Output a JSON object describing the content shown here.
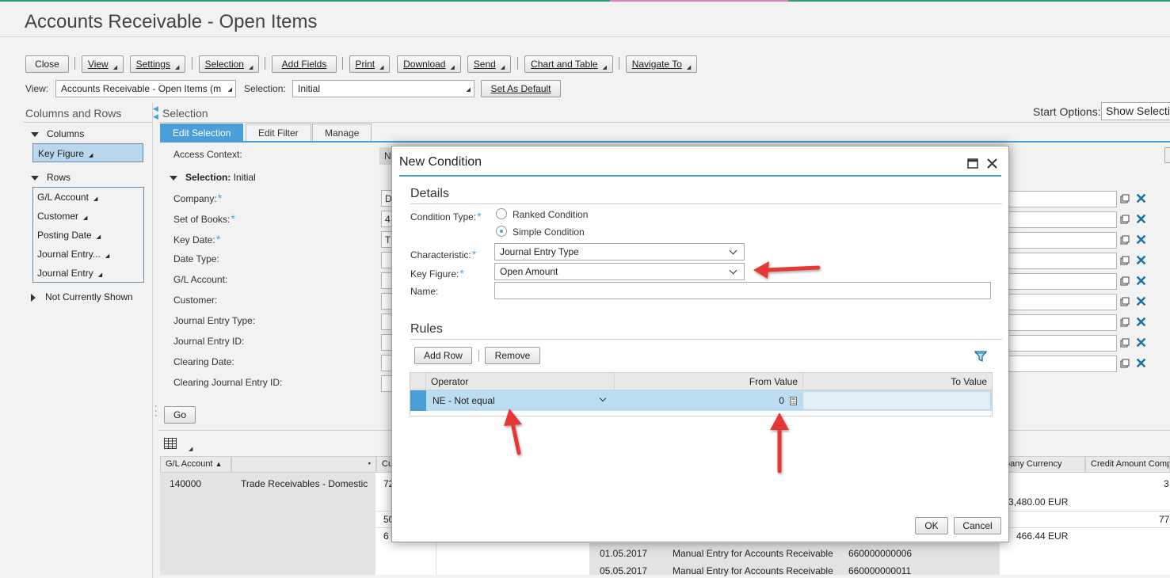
{
  "page": {
    "title": "Accounts Receivable - Open Items"
  },
  "toolbar": {
    "close": "Close",
    "view": "View",
    "settings": "Settings",
    "selection": "Selection",
    "add_fields": "Add Fields",
    "print": "Print",
    "download": "Download",
    "send": "Send",
    "chart_and_table": "Chart and Table",
    "navigate_to": "Navigate To"
  },
  "view_bar": {
    "view_label": "View:",
    "view_value": "Accounts Receivable - Open Items (m",
    "selection_label": "Selection:",
    "selection_value": "Initial",
    "set_default": "Set As Default"
  },
  "left_panel": {
    "title": "Columns and Rows",
    "columns_label": "Columns",
    "columns": [
      "Key Figure"
    ],
    "rows_label": "Rows",
    "rows": [
      "G/L Account",
      "Customer",
      "Posting Date",
      "Journal Entry...",
      "Journal Entry"
    ],
    "not_shown": "Not Currently Shown"
  },
  "selection_panel": {
    "title": "Selection",
    "start_options_label": "Start Options:",
    "start_options_value": "Show Selecti",
    "tabs": [
      "Edit Selection",
      "Edit Filter",
      "Manage"
    ],
    "access_context": "Access Context:",
    "selection_header": "Selection:",
    "selection_name": "Initial",
    "fields": [
      "Company:",
      "Set of Books:",
      "Key Date:",
      "Date Type:",
      "G/L Account:",
      "Customer:",
      "Journal Entry Type:",
      "Journal Entry ID:",
      "Clearing Date:",
      "Clearing Journal Entry ID:"
    ],
    "field_stubs": [
      "N",
      "D",
      "4",
      "T"
    ],
    "go": "Go"
  },
  "grid": {
    "headers": [
      "G/L Account",
      "Cu",
      "pany Currency",
      "Credit Amount Comp"
    ],
    "rows": [
      {
        "gl": "140000",
        "desc": "Trade Receivables - Domestic",
        "cu": "72",
        "amount": "3,480.00 EUR",
        "right": "3"
      },
      {
        "cu": "50",
        "right": "77"
      },
      {
        "cu": "6",
        "amount": "466.44 EUR"
      }
    ],
    "entries": [
      {
        "date": "01.05.2017",
        "text": "Manual Entry for Accounts Receivable",
        "id": "660000000006"
      },
      {
        "date": "05.05.2017",
        "text": "Manual Entry for Accounts Receivable",
        "id": "660000000011"
      }
    ]
  },
  "dialog": {
    "title": "New Condition",
    "details_heading": "Details",
    "condition_type_label": "Condition Type:",
    "ranked": "Ranked Condition",
    "simple": "Simple Condition",
    "characteristic_label": "Characteristic:",
    "characteristic_value": "Journal Entry Type",
    "key_figure_label": "Key Figure:",
    "key_figure_value": "Open Amount",
    "name_label": "Name:",
    "name_value": "",
    "rules_heading": "Rules",
    "add_row": "Add Row",
    "remove": "Remove",
    "columns": [
      "Operator",
      "From Value",
      "To Value"
    ],
    "rule": {
      "operator": "NE - Not equal",
      "from": "0",
      "to": ""
    },
    "ok": "OK",
    "cancel": "Cancel"
  },
  "colors": {
    "accent": "#4aa0d6",
    "arrow": "#e53935",
    "delete": "#1a6ea8"
  }
}
